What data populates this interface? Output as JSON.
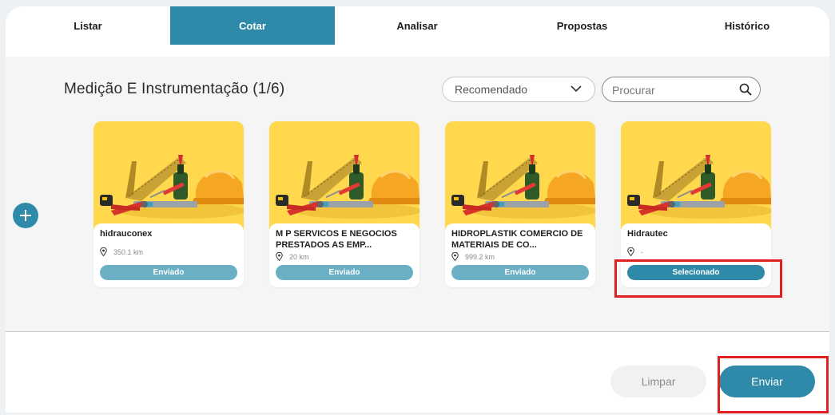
{
  "tabs": [
    {
      "label": "Listar",
      "active": false
    },
    {
      "label": "Cotar",
      "active": true
    },
    {
      "label": "Analisar",
      "active": false
    },
    {
      "label": "Propostas",
      "active": false
    },
    {
      "label": "Histórico",
      "active": false
    }
  ],
  "section": {
    "title": "Medição E Instrumentação (1/6)"
  },
  "sort": {
    "selected": "Recomendado"
  },
  "search": {
    "placeholder": "Procurar",
    "value": ""
  },
  "suppliers": [
    {
      "name": "hidrauconex",
      "distance": "350.1 km",
      "status": "Enviado"
    },
    {
      "name": "M P SERVICOS E NEGOCIOS PRESTADOS AS EMP...",
      "distance": "20 km",
      "status": "Enviado"
    },
    {
      "name": "HIDROPLASTIK COMERCIO DE MATERIAIS DE CO...",
      "distance": "999.2 km",
      "status": "Enviado"
    },
    {
      "name": "Hidrautec",
      "distance": "-",
      "status": "Selecionado"
    }
  ],
  "actions": {
    "clear_label": "Limpar",
    "send_label": "Enviar"
  },
  "icons": {
    "dropdown": "chevron-down-icon",
    "search": "search-icon",
    "add": "plus-icon",
    "location": "location-pin-icon",
    "tools": "tools-image"
  },
  "colors": {
    "primary": "#2e8aa8",
    "sent_badge": "#6aafc4",
    "card_image_bg": "#ffd84e",
    "highlight": "#e02020"
  }
}
